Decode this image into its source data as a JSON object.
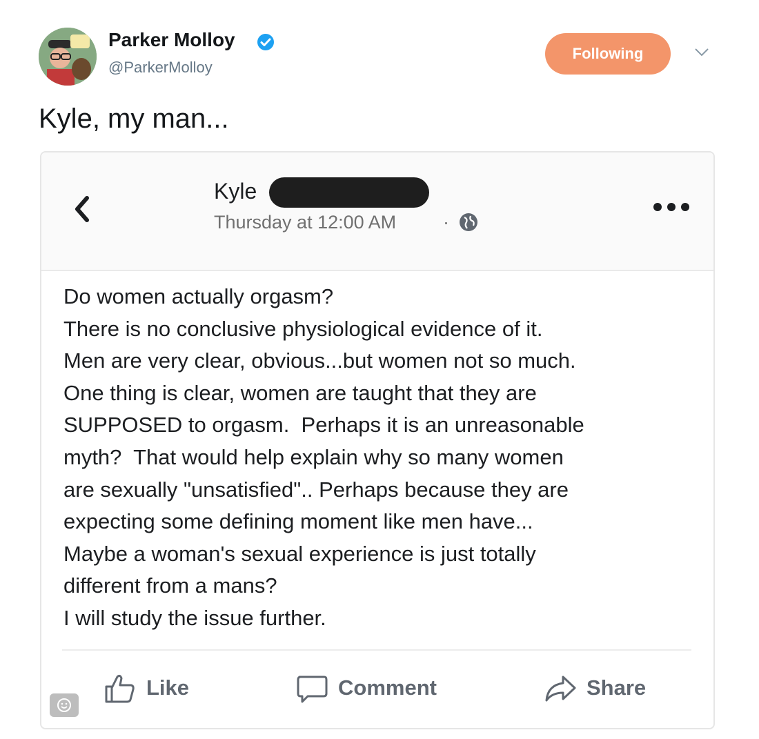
{
  "tweet": {
    "author_name": "Parker Molloy",
    "handle": "@ParkerMolloy",
    "follow_label": "Following",
    "text": "Kyle, my man...",
    "colors": {
      "follow_button": "#f3956a",
      "verified": "#1da1f2"
    }
  },
  "fb_post": {
    "poster_name": "Kyle",
    "timestamp": "Thursday at 12:00 AM",
    "separator": "·",
    "body_lines": [
      "Do women actually orgasm?",
      "There is no conclusive physiological evidence of it.",
      "Men are very clear, obvious...but women not so much.",
      "One thing is clear, women are taught that they are",
      "SUPPOSED to orgasm.  Perhaps it is an unreasonable",
      "myth?  That would help explain why so many women",
      "are sexually \"unsatisfied\".. Perhaps because they are",
      "expecting some defining moment like men have...",
      "Maybe a woman's sexual experience is just totally",
      "different from a mans?",
      "I will study the issue further."
    ],
    "actions": {
      "like": "Like",
      "comment": "Comment",
      "share": "Share"
    },
    "icons": [
      "back-icon",
      "globe-icon",
      "more-icon",
      "like-icon",
      "comment-icon",
      "share-icon",
      "emoji-icon"
    ]
  }
}
